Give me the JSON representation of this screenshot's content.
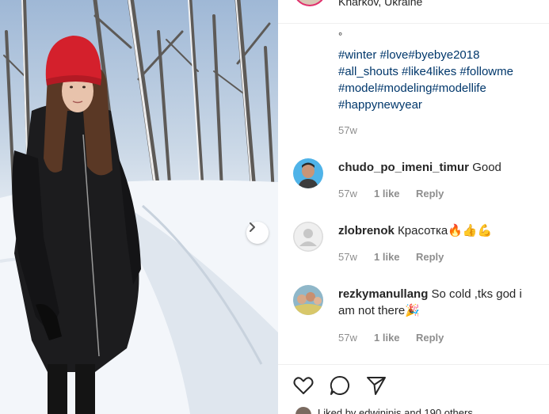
{
  "post": {
    "location": "Kharkov, Ukraine",
    "caption_dot": "°",
    "hashtags": [
      "#winter #love#byebye2018",
      "#all_shouts #like4likes #followme",
      "#model#modeling#modellife",
      "#happynewyear"
    ],
    "caption_time": "57w"
  },
  "comments": [
    {
      "username": "chudo_po_imeni_timur",
      "text": "Good",
      "time": "57w",
      "likes": "1 like",
      "reply": "Reply"
    },
    {
      "username": "zlobrenok",
      "text": "Красотка🔥👍💪",
      "time": "57w",
      "likes": "1 like",
      "reply": "Reply"
    },
    {
      "username": "rezkymanullang",
      "text": "So cold ,tks god i am not there🎉",
      "time": "57w",
      "likes": "1 like",
      "reply": "Reply"
    }
  ],
  "footer": {
    "liked_by": "Liked by edwinipis and 190 others"
  },
  "icons": {
    "like": "heart-icon",
    "comment": "comment-icon",
    "share": "share-icon",
    "next": "chevron-right-icon"
  },
  "colors": {
    "hashtag": "#00376b",
    "meta": "#8e8e8e",
    "ring": "#e1306c"
  }
}
